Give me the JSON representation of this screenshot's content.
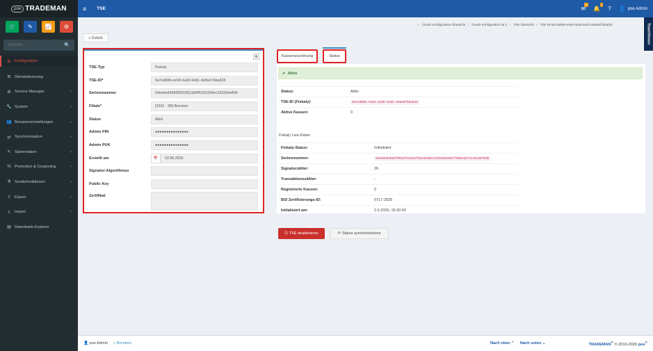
{
  "brand": {
    "logo_small": "poe",
    "logo_text": "TRADEMAN"
  },
  "header": {
    "page_title": "TSE",
    "user": "poe Admin",
    "badge_mail": "10",
    "badge_bell": "1",
    "teamviewer": "TeamViewer"
  },
  "sidebar": {
    "search_placeholder": "Suchen...",
    "items": [
      {
        "label": "Konfiguration",
        "icon": "gears-icon",
        "active": true
      },
      {
        "label": "Dienststeuerung",
        "icon": "cog-icon"
      },
      {
        "label": "Service-Manager",
        "icon": "cogs-icon",
        "chevron": true
      },
      {
        "label": "System",
        "icon": "wrench-icon",
        "chevron": true
      },
      {
        "label": "Benutzereinstellungen",
        "icon": "users-icon",
        "chevron": true
      },
      {
        "label": "Synchronisation",
        "icon": "shuffle-icon",
        "chevron": true
      },
      {
        "label": "Stammdaten",
        "icon": "pencil-icon",
        "chevron": true
      },
      {
        "label": "Promotion & Couponing",
        "icon": "percent-icon",
        "chevron": true
      },
      {
        "label": "Sonderfunktionen",
        "icon": "flask-icon",
        "chevron": true
      },
      {
        "label": "Export",
        "icon": "upload-icon",
        "chevron": true
      },
      {
        "label": "Import",
        "icon": "download-icon",
        "chevron": true
      },
      {
        "label": "Datenbank-Explorer",
        "icon": "database-icon"
      }
    ]
  },
  "breadcrumb": [
    "OAuth Konfiguration-Übersicht",
    "OAuth Konfiguration Nr.1",
    "TSE-Übersicht",
    "TSE Nr.9a7ed69b-ee93-4a36-94d1-de8a67bba828"
  ],
  "back_label": "« Zurück",
  "form": {
    "tse_typ": {
      "label": "TSE-Typ",
      "value": "Fiskaly"
    },
    "tse_id": {
      "label": "TSE-ID*",
      "value": "9a7ed69b-ee93-4a36-94d1-de8a67bba828"
    },
    "serial": {
      "label": "Seriennummer",
      "value": "64eebe94682f0533f11d54f5163160ec33333eb459"
    },
    "filiale": {
      "label": "Filiale*",
      "value": "[1031 - 3R] Brenken"
    },
    "status": {
      "label": "Status",
      "value": "Aktiv"
    },
    "admin_pin": {
      "label": "Admin PIN",
      "value": "●●●●●●●●●●●●●●●"
    },
    "admin_puk": {
      "label": "Admin PUK",
      "value": "●●●●●●●●●●●●●●●"
    },
    "erstellt": {
      "label": "Erstellt am",
      "value": "02.06.2026"
    },
    "algo": {
      "label": "Signatur-Algorithmus",
      "value": ""
    },
    "public_key": {
      "label": "Public Key",
      "value": ""
    },
    "zertifikat": {
      "label": "Zertifikat",
      "value": ""
    }
  },
  "tabs": {
    "kassen": "Kassenzuordnung",
    "status": "Status"
  },
  "status_panel": {
    "alert": "Aktiv",
    "rows": [
      {
        "key": "Status:",
        "val": "Aktiv"
      },
      {
        "key": "TSE-ID (Fiskaly):",
        "val": "9a7ed69b-ee93-4a36-94d1-de8a67bba828",
        "code": true
      },
      {
        "key": "Aktive Kassen:",
        "val": "0"
      }
    ],
    "live_title": "Fiskaly Live-Daten",
    "live_rows": [
      {
        "key": "Fiskaly-Status:",
        "val": "Initialisiert"
      },
      {
        "key": "Seriennummer:",
        "val": "64eebe94682f0533f11d54f5163160ec33333eb459cf0604d274c18c3070db",
        "code": true
      },
      {
        "key": "Signaturzähler:",
        "val": "26"
      },
      {
        "key": "Transaktionszähler:",
        "val": "-"
      },
      {
        "key": "Registrierte Kassen:",
        "val": "0"
      },
      {
        "key": "BSI Zertifizierungs-ID:",
        "val": "0717-2025"
      },
      {
        "key": "Initialisiert am:",
        "val": "2.6.2026, 15:30:00"
      }
    ],
    "btn_deactivate": "TSE deaktivieren",
    "btn_sync": "Status synchronisieren"
  },
  "footer": {
    "user": "poe Admin",
    "branch": "Brenken",
    "top": "Nach oben",
    "down": "Nach unten",
    "copyright_brand": "TRADEMAN",
    "copyright_text": "© 2010-2026",
    "copyright_poe": "poe"
  },
  "colors": {
    "header": "#1f5aa6",
    "sidebar": "#222d32",
    "highlight": "#e02222"
  }
}
